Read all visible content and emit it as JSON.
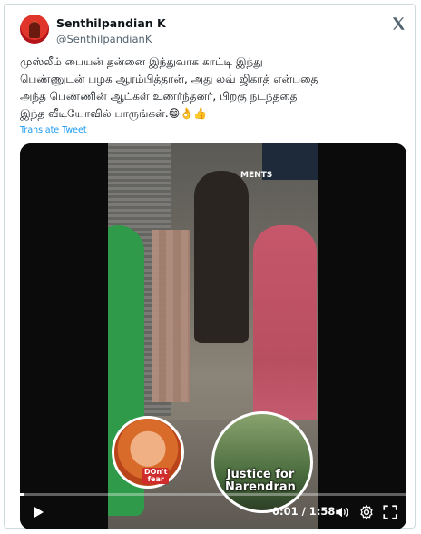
{
  "author": {
    "name": "Senthilpandian K",
    "handle": "@SenthilpandianK"
  },
  "tweet": {
    "text": "முஸ்லீம் பையன் தன்னை இந்துவாக காட்டி இந்து\nபெண்ணுடன் பழக ஆரம்பித்தான், அது லவ் ஜிகாத் என்பதை\nஅந்த பெண்ணின் ஆட்கள் உணர்ந்தனர், பிறகு நடந்ததை\nஇந்த வீடியோவில் பாருங்கள்.",
    "emojis": "😁👌👍",
    "translate_label": "Translate Tweet"
  },
  "video": {
    "badge_left_label": "DOn't\nfear",
    "badge_right_label": "Justice for\nNarendran",
    "sign_text": "MENTS",
    "time": "0:01 / 1:58",
    "progress": 0.01
  },
  "icons": {
    "play": "play-icon",
    "volume": "volume-icon",
    "settings": "gear-icon",
    "fullscreen": "fullscreen-icon",
    "logo": "x-logo-icon"
  }
}
